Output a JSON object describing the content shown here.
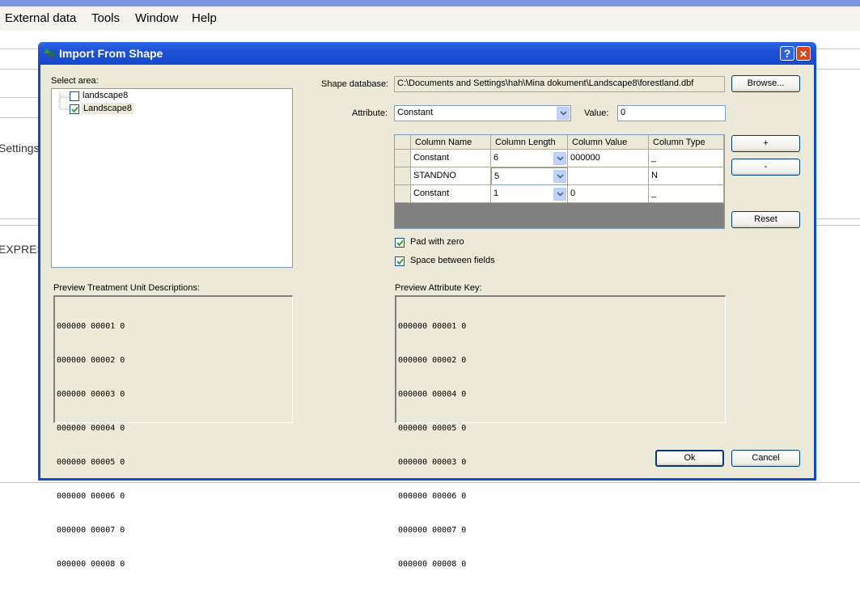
{
  "menubar": {
    "items": [
      "External data",
      "Tools",
      "Window",
      "Help"
    ]
  },
  "background": {
    "settings_text": "Settings",
    "express_text": "EXPRESS"
  },
  "dialog": {
    "title": "Import From Shape",
    "help_symbol": "?",
    "close_symbol": "✕",
    "title_icon": "tree-icon"
  },
  "select_area": {
    "label": "Select area:",
    "items": [
      {
        "label": "landscape8",
        "checked": false
      },
      {
        "label": "Landscape8",
        "checked": true
      }
    ]
  },
  "shape_database": {
    "label": "Shape database:",
    "value": "C:\\Documents and Settings\\hah\\Mina dokument\\Landscape8\\forestland.dbf",
    "browse_label": "Browse..."
  },
  "attribute": {
    "label": "Attribute:",
    "selected": "Constant",
    "value_label": "Value:",
    "value": "0"
  },
  "grid": {
    "headers": [
      "Column Name",
      "Column Length",
      "Column Value",
      "Column Type"
    ],
    "rows": [
      {
        "name": "Constant",
        "length": "6",
        "value": "000000",
        "type": "_"
      },
      {
        "name": "STANDNO",
        "length": "5",
        "value": "",
        "type": "N"
      },
      {
        "name": "Constant",
        "length": "1",
        "value": "0",
        "type": "_"
      }
    ]
  },
  "side_buttons": {
    "add": "+",
    "remove": "-",
    "reset": "Reset"
  },
  "options": {
    "pad_with_zero": {
      "label": "Pad with zero",
      "checked": true
    },
    "space_between_fields": {
      "label": "Space between fields",
      "checked": true
    }
  },
  "preview_treatment": {
    "label": "Preview Treatment Unit Descriptions:",
    "lines": [
      "000000 00001 0",
      "000000 00002 0",
      "000000 00003 0",
      "000000 00004 0",
      "000000 00005 0",
      "000000 00006 0",
      "000000 00007 0",
      "000000 00008 0"
    ]
  },
  "preview_attribute": {
    "label": "Preview Attribute Key:",
    "lines": [
      "000000 00001 0",
      "000000 00002 0",
      "000000 00004 0",
      "000000 00005 0",
      "000000 00003 0",
      "000000 00006 0",
      "000000 00007 0",
      "000000 00008 0"
    ]
  },
  "footer": {
    "ok_label": "Ok",
    "cancel_label": "Cancel"
  },
  "colors": {
    "titlebar": "#1c52d8",
    "dialog_face": "#ece9d8",
    "grid_empty": "#808080"
  }
}
